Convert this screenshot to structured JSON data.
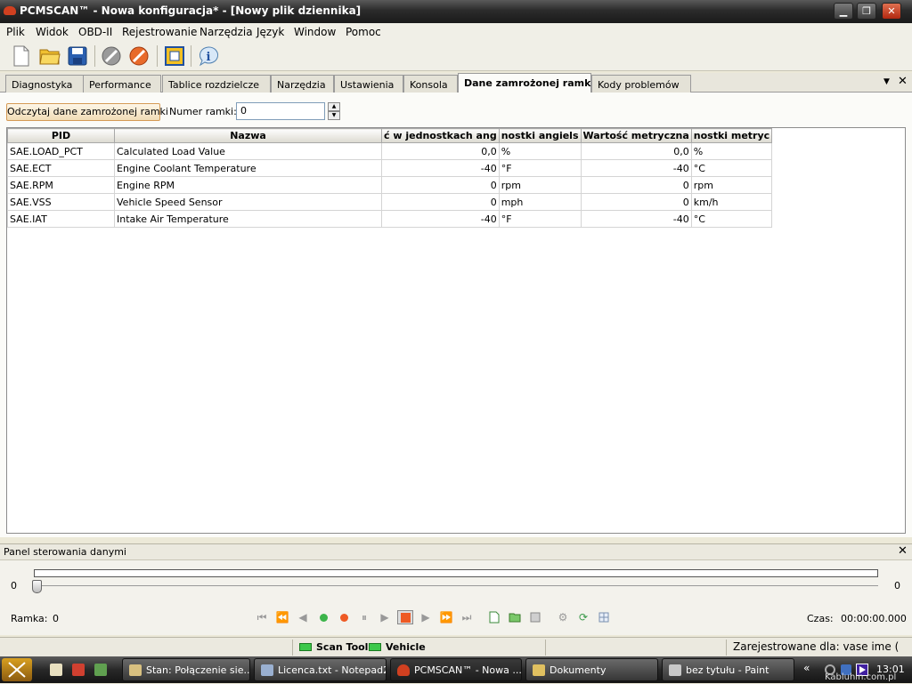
{
  "window": {
    "title": "PCMSCAN™ - Nowa konfiguracja* - [Nowy plik dziennika]"
  },
  "menu": [
    "Plik",
    "Widok",
    "OBD-II",
    "Rejestrowanie",
    "Narzędzia",
    "Język",
    "Window",
    "Pomoc"
  ],
  "toolbar_icons": [
    "new-file-icon",
    "open-folder-icon",
    "save-disk-icon",
    "disconnect-plug-icon",
    "connect-plug-icon",
    "screen-fit-icon",
    "info-icon"
  ],
  "tabs": [
    {
      "label": "Diagnostyka",
      "active": false
    },
    {
      "label": "Performance",
      "active": false
    },
    {
      "label": "Tablice rozdzielcze",
      "active": false
    },
    {
      "label": "Narzędzia",
      "active": false
    },
    {
      "label": "Ustawienia",
      "active": false
    },
    {
      "label": "Konsola",
      "active": false
    },
    {
      "label": "Dane zamrożonej ramki",
      "active": true
    },
    {
      "label": "Kody problemów",
      "active": false
    }
  ],
  "freeze": {
    "read_button": "Odczytaj dane zamrożonej ramki",
    "frame_label": "Numer ramki:",
    "frame_value": "0"
  },
  "grid": {
    "columns": [
      "PID",
      "Nazwa",
      "ć w jednostkach ang",
      "nostki angiels",
      "Wartość metryczna",
      "nostki metryc"
    ],
    "rows": [
      [
        "SAE.LOAD_PCT",
        "Calculated Load Value",
        "0,0",
        "%",
        "0,0",
        "%"
      ],
      [
        "SAE.ECT",
        "Engine Coolant Temperature",
        "-40",
        "°F",
        "-40",
        "°C"
      ],
      [
        "SAE.RPM",
        "Engine RPM",
        "0",
        "rpm",
        "0",
        "rpm"
      ],
      [
        "SAE.VSS",
        "Vehicle Speed Sensor",
        "0",
        "mph",
        "0",
        "km/h"
      ],
      [
        "SAE.IAT",
        "Intake Air Temperature",
        "-40",
        "°F",
        "-40",
        "°C"
      ]
    ]
  },
  "control_panel": {
    "title": "Panel sterowania danymi",
    "slider_min": "0",
    "slider_max": "0",
    "frame_label": "Ramka:",
    "frame_value": "0",
    "time_label": "Czas:",
    "time_value": "00:00:00.000"
  },
  "status": {
    "scan_tool": "Scan Tool",
    "vehicle": "Vehicle",
    "registered": "Zarejestrowane dla: vase ime ("
  },
  "taskbar": {
    "tasks": [
      {
        "label": "Stan: Połączenie sie...",
        "icon_color": "#d8c080",
        "active": false
      },
      {
        "label": "Licenca.txt - Notepad2",
        "icon_color": "#9ab0d0",
        "active": false
      },
      {
        "label": "PCMSCAN™ - Nowa ...",
        "icon_color": "#d04020",
        "active": true
      },
      {
        "label": "Dokumenty",
        "icon_color": "#e0c060",
        "active": false
      },
      {
        "label": "bez tytułu - Paint",
        "icon_color": "#c8c8c8",
        "active": false
      }
    ],
    "clock": "13:01",
    "watermark": "Kabluhin.com.pl"
  }
}
